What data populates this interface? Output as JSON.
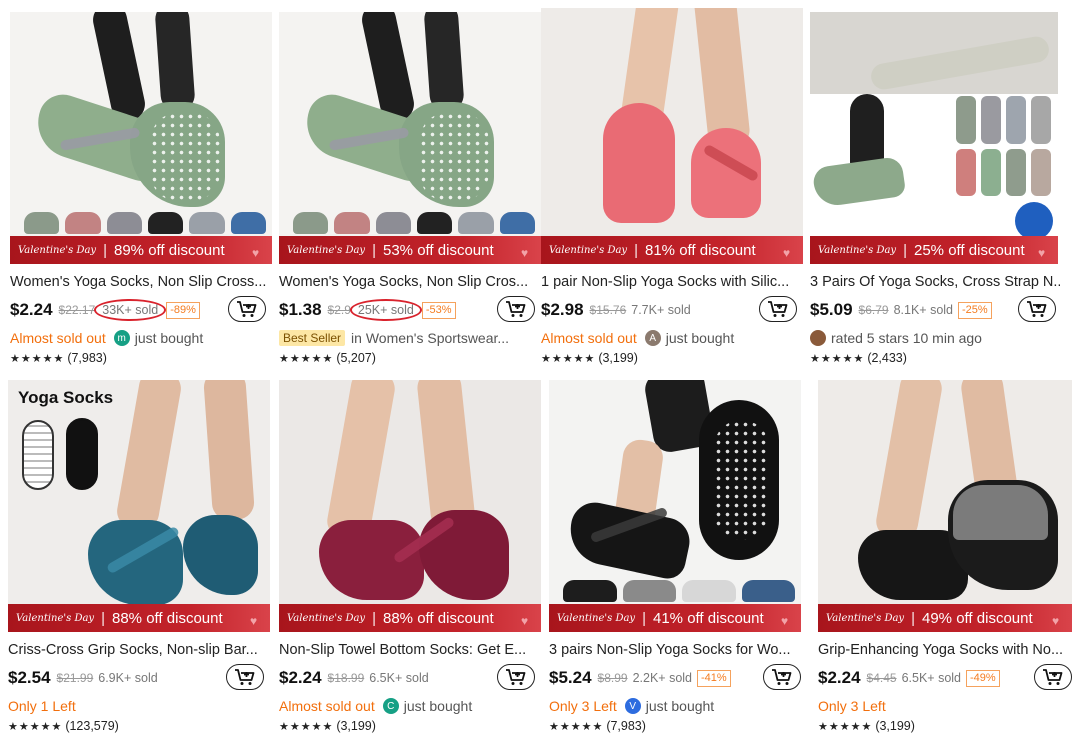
{
  "colors": {
    "banner_red": "#c4232b",
    "accent_orange": "#f26f0d",
    "circle_red": "#d9232d"
  },
  "banner": {
    "event": "Valentine's Day"
  },
  "products": [
    {
      "title": "Women's Yoga Socks, Non Slip Cross...",
      "price": "$2.24",
      "orig": "$22.17",
      "sold": "33K+ sold",
      "discount": "-89%",
      "banner_text": "89% off discount",
      "status": "Almost sold out",
      "avatar_letter": "m",
      "activity": "just bought",
      "stars": "★★★★★",
      "reviews": "(7,983)",
      "cart_icon": "cart-plus-icon"
    },
    {
      "title": "Women's Yoga Socks, Non Slip Cros...",
      "price": "$1.38",
      "orig": "$2.9",
      "sold": "25K+ sold",
      "discount": "-53%",
      "banner_text": "53% off discount",
      "badge": "Best Seller",
      "activity": "in Women's Sportswear...",
      "stars": "★★★★★",
      "reviews": "(5,207)",
      "cart_icon": "cart-plus-icon"
    },
    {
      "title": "1 pair Non-Slip Yoga Socks with Silic...",
      "price": "$2.98",
      "orig": "$15.76",
      "sold": "7.7K+ sold",
      "banner_text": "81% off discount",
      "status": "Almost sold out",
      "avatar_letter": "A",
      "activity": "just bought",
      "stars": "★★★★★",
      "reviews": "(3,199)",
      "cart_icon": "cart-plus-icon"
    },
    {
      "title": "3 Pairs Of Yoga Socks, Cross Strap N...",
      "price": "$5.09",
      "orig": "$6.79",
      "sold": "8.1K+ sold",
      "discount": "-25%",
      "banner_text": "25% off discount",
      "activity": "rated 5 stars 10 min ago",
      "stars": "★★★★★",
      "reviews": "(2,433)",
      "cart_icon": "cart-plus-icon"
    },
    {
      "title": "Criss-Cross Grip Socks, Non-slip Bar...",
      "price": "$2.54",
      "orig": "$21.99",
      "sold": "6.9K+ sold",
      "banner_text": "88% off discount",
      "status": "Only 1 Left",
      "image_label": "Yoga Socks",
      "stars": "★★★★★",
      "reviews": "(123,579)",
      "cart_icon": "cart-plus-icon"
    },
    {
      "title": "Non-Slip Towel Bottom Socks: Get E...",
      "price": "$2.24",
      "orig": "$18.99",
      "sold": "6.5K+ sold",
      "banner_text": "88% off discount",
      "status": "Almost sold out",
      "avatar_letter": "C",
      "activity": "just bought",
      "stars": "★★★★★",
      "reviews": "(3,199)",
      "cart_icon": "cart-plus-icon"
    },
    {
      "title": "3 pairs Non-Slip Yoga Socks for Wo...",
      "price": "$5.24",
      "orig": "$8.99",
      "sold": "2.2K+ sold",
      "discount": "-41%",
      "banner_text": "41% off discount",
      "status": "Only 3 Left",
      "avatar_letter": "V",
      "activity": "just bought",
      "stars": "★★★★★",
      "reviews": "(7,983)",
      "cart_icon": "cart-plus-icon"
    },
    {
      "title": "Grip-Enhancing Yoga Socks with No...",
      "price": "$2.24",
      "orig": "$4.45",
      "sold": "6.5K+ sold",
      "discount": "-49%",
      "banner_text": "49% off discount",
      "status": "Only 3 Left",
      "stars": "★★★★★",
      "reviews": "(3,199)",
      "cart_icon": "cart-plus-icon"
    }
  ]
}
